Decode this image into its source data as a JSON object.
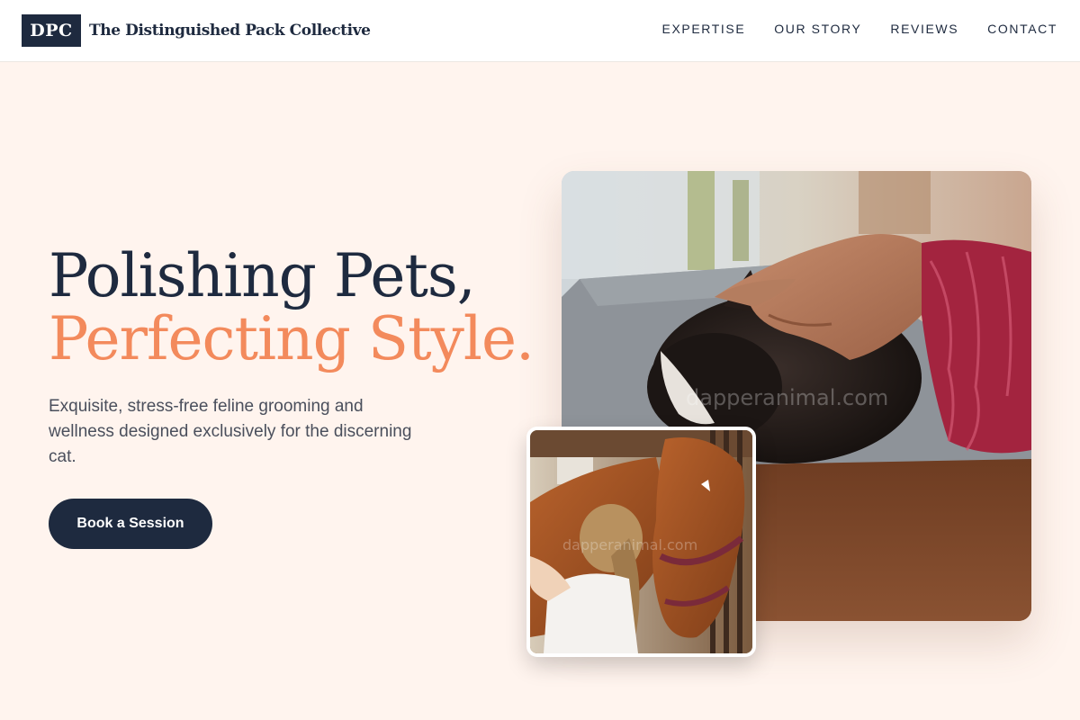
{
  "header": {
    "logo_mark": "DPC",
    "brand_name": "The Distinguished Pack Collective",
    "nav": [
      {
        "label": "EXPERTISE"
      },
      {
        "label": "OUR STORY"
      },
      {
        "label": "REVIEWS"
      },
      {
        "label": "CONTACT"
      }
    ]
  },
  "hero": {
    "title_line1": "Polishing Pets,",
    "title_line2": "Perfecting Style.",
    "subtitle": "Exquisite, stress-free feline grooming and wellness designed exclusively for the discerning cat.",
    "cta_label": "Book a Session"
  },
  "images": {
    "main_watermark": "dapperanimal.com",
    "secondary_watermark": "dapperanimal.com"
  },
  "colors": {
    "background": "#fff4ee",
    "navy": "#1e2a3f",
    "accent": "#f38a5c"
  }
}
